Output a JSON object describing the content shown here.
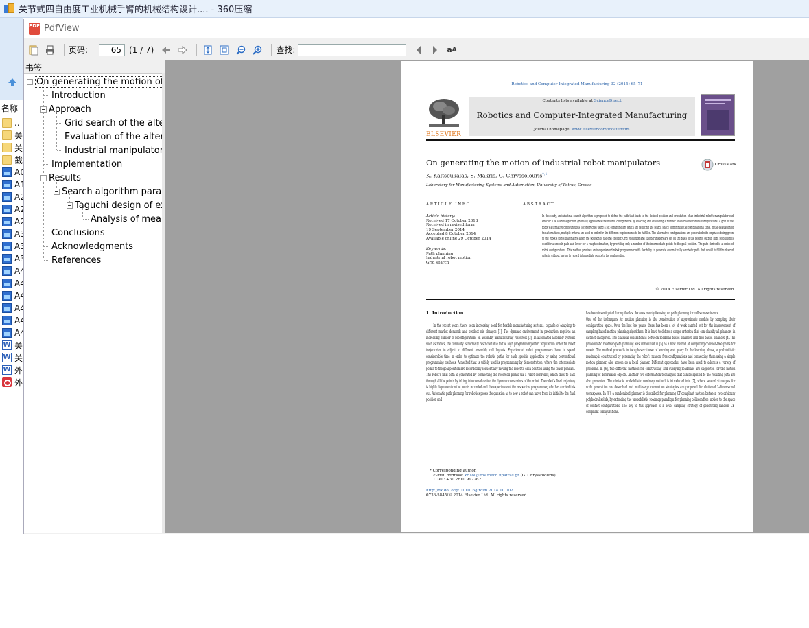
{
  "outer_window": {
    "title": "关节式四自由度工业机械手臂的机械结构设计.... - 360压缩",
    "name_column": "名称",
    "files": [
      {
        "icon": "folder-icon",
        "label": ".. ("
      },
      {
        "icon": "folder-icon",
        "label": "关"
      },
      {
        "icon": "folder-icon",
        "label": "关"
      },
      {
        "icon": "folder-icon",
        "label": "截"
      },
      {
        "icon": "image-file-icon",
        "label": "A0"
      },
      {
        "icon": "image-file-icon",
        "label": "A1"
      },
      {
        "icon": "image-file-icon",
        "label": "A2"
      },
      {
        "icon": "image-file-icon",
        "label": "A2"
      },
      {
        "icon": "image-file-icon",
        "label": "A2"
      },
      {
        "icon": "image-file-icon",
        "label": "A3"
      },
      {
        "icon": "image-file-icon",
        "label": "A3"
      },
      {
        "icon": "image-file-icon",
        "label": "A3"
      },
      {
        "icon": "image-file-icon",
        "label": "A4"
      },
      {
        "icon": "image-file-icon",
        "label": "A4"
      },
      {
        "icon": "image-file-icon",
        "label": "A4"
      },
      {
        "icon": "image-file-icon",
        "label": "A4"
      },
      {
        "icon": "image-file-icon",
        "label": "A4"
      },
      {
        "icon": "image-file-icon",
        "label": "A4"
      },
      {
        "icon": "word-file-icon",
        "label": "关"
      },
      {
        "icon": "word-file-icon",
        "label": "关"
      },
      {
        "icon": "word-file-icon",
        "label": "外"
      },
      {
        "icon": "pdf-file-icon",
        "label": "外"
      }
    ]
  },
  "pdfview": {
    "title": "PdfView",
    "toolbar": {
      "page_label": "页码:",
      "page_value": "65",
      "page_count": "(1 / 7)",
      "find_label": "查找:",
      "find_value": ""
    },
    "bookmark_header": "书签",
    "bookmarks": [
      {
        "label": "On generating the motion of in"
      },
      {
        "label": "Introduction"
      },
      {
        "label": "Approach"
      },
      {
        "label": "Grid search of the altern"
      },
      {
        "label": "Evaluation of the alterna"
      },
      {
        "label": "Industrial manipulator m"
      },
      {
        "label": "Implementation"
      },
      {
        "label": "Results"
      },
      {
        "label": "Search algorithm param"
      },
      {
        "label": "Taguchi design of ex"
      },
      {
        "label": "Analysis of means"
      },
      {
        "label": "Conclusions"
      },
      {
        "label": "Acknowledgments"
      },
      {
        "label": "References"
      }
    ]
  },
  "paper": {
    "journal_ref": "Robotics and Computer-Integrated Manufacturing 32 (2015) 65–71",
    "contents_prefix": "Contents lists available at ",
    "contents_link": "ScienceDirect",
    "journal_name": "Robotics and Computer-Integrated Manufacturing",
    "homepage_prefix": "journal homepage: ",
    "homepage_link": "www.elsevier.com/locate/rcim",
    "publisher": "ELSEVIER",
    "title": "On generating the motion of industrial robot manipulators",
    "authors": "K. Kaltsoukalas, S. Makris, G. Chryssolouris",
    "author_marks": "*,1",
    "affiliation": "Laboratory for Manufacturing Systems and Automation, University of Patras, Greece",
    "crossmark": "CrossMark",
    "article_info_heading": "A R T I C L E   I N F O",
    "abstract_heading": "A B S T R A C T",
    "history": [
      "Article history:",
      "Received 17 October 2013",
      "Received in revised form",
      "19 September 2014",
      "Accepted 8 October 2014",
      "Available online 29 October 2014"
    ],
    "keywords": [
      "Keywords:",
      "Path planning",
      "Industrial robot motion",
      "Grid search"
    ],
    "abstract": "In this study, an industrial search algorithm is proposed to define the path that leads to the desired position and orientation of an industrial robot's manipulator end effector. The search algorithm gradually approaches the desired configuration by selecting and evaluating a number of alternative robot's configurations. A grid of the robot's alternative configurations is constructed using a set of parameters which are reducing the search space to minimize the computational time. In the evaluation of the alternatives, multiple criteria are used in order for the different requirements to be fulfilled. The alternative configurations are generated with emphasis being given to the robot's joints that mainly affect the position of the end effector. Grid resolution and size parameters are set on the basis of the desired output. High resolution is used for a smooth path and lower for a rough estimation, by providing only a number of the intermediate points to the goal position. The path derived is a series of robot configurations. This method provides an inexperienced robot programmer with flexibility to generate automatically a robotic path that would fulfill the desired criteria without having to record intermediate points to the goal position.",
    "copyright": "© 2014 Elsevier Ltd. All rights reserved.",
    "section1_heading": "1.  Introduction",
    "col1_text": "In the recent years, there is an increasing need for flexible manufacturing systems, capable of adapting to different market demands and product-mix changes [1]. The dynamic environment in production requires an increasing number of reconfigurations on assembly manufacturing resources [3]. In automated assembly systems such as robots, the flexibility is normally restricted due to the high programming effort required in order for robot trajectories to adjust to different assembly cell layouts. Experienced robot programmers have to spend considerable time in order to optimize the robotic paths for each specific application by using conventional programming methods. A method that is widely used is programming by demonstration, where the intermediate points to the goal position are recorded by sequentially moving the robot to each position using the teach pendant. The robot's final path is generated by connecting the recorded points via a robot controller, which tries to pass through all the points by taking into consideration the dynamic constraints of the robot. The robot's final trajectory is highly dependent on the points recorded and the experience of the respective programmer, who has carried this out. Automatic path planning for robotics poses the question as to how a robot can move from its initial to the final position and",
    "col2_text": "has been investigated during the last decades mainly focusing on path planning for collision avoidance.\nOne of the techniques for motion planning is the construction of approximate models by sampling their configuration space. Over the last few years, there has been a lot of work carried out for the improvement of sampling based motion planning algorithms. It is hard to define a single criterion that can classify all planners in distinct categories. The classical separation is between roadmap-based planners and tree-based planners [4].The probabilistic roadmap path planning was introduced in [5] as a new method of computing collision-free paths for robots. The method proceeds in two phases: those of learning and query. In the learning phase, a probabilistic roadmap is constructed by generating the robot's random free configurations and connecting them using a simple motion planner, also known as a local planner. Different approaches have been used to address a variety of problems. In [6], two different methods for constructing and querying roadmaps are suggested for the motion planning of deformable objects. Another two deformation techniques that can be applied to the resulting path are also presented. The obstacle probabilistic roadmap method is introduced into [7], where several strategies for node generation are described and multi-stage connection strategies are proposed for cluttered 3-dimensional workspaces. In [8], a randomized planner is described for planning CF-compliant motion between two arbitrary polyhedral solids, by extending the probabilistic roadmap paradigm for planning collision-free motion to the space of contact configurations. The key to this approach is a novel sampling strategy of generating random CF-compliant configurations.",
    "footnote_corr": "* Corresponding author.",
    "footnote_email_prefix": "E-mail address: ",
    "footnote_email": "xrisol@lms.mech.upatras.gr",
    "footnote_email_suffix": " (G. Chryssolouris).",
    "footnote_tel": "1  Tel.: +30 2610 997262.",
    "doi": "http://dx.doi.org/10.1016/j.rcim.2014.10.002",
    "issn": "0736-5845/© 2014 Elsevier Ltd. All rights reserved."
  },
  "colors": {
    "viewer_bg": "#a0a0a0",
    "link": "#2a62a8",
    "elsevier_orange": "#e07b24",
    "pdf_red": "#e04b3c"
  }
}
